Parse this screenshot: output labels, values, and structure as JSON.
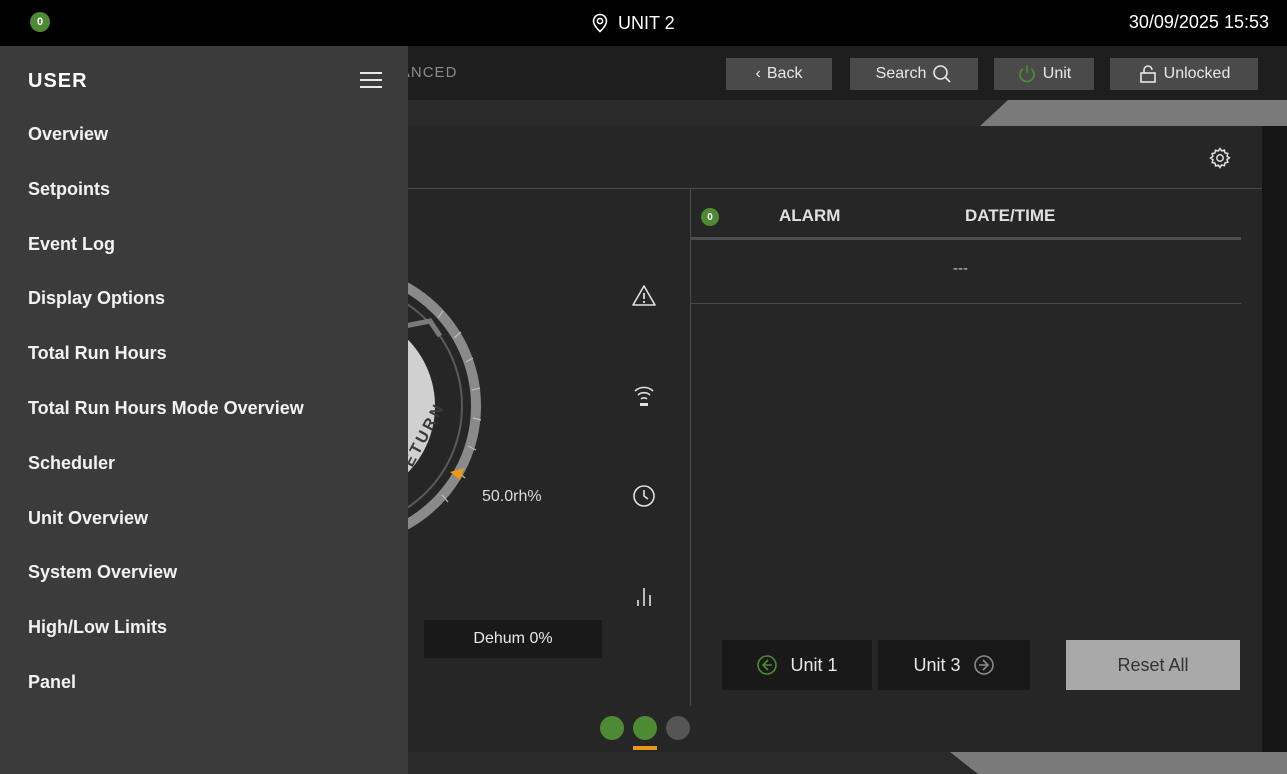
{
  "topbar": {
    "alarm_badge": "0",
    "unit_label": "UNIT 2",
    "datetime": "30/09/2025 15:53"
  },
  "toolbar": {
    "partial_tab": "VANCED",
    "back_label": "Back",
    "search_label": "Search",
    "unit_label": "Unit",
    "lock_label": "Unlocked"
  },
  "menu": {
    "title": "USER",
    "items": [
      {
        "label": "Overview"
      },
      {
        "label": "Setpoints"
      },
      {
        "label": "Event Log"
      },
      {
        "label": "Display Options"
      },
      {
        "label": "Total Run Hours"
      },
      {
        "label": "Total Run Hours Mode Overview"
      },
      {
        "label": "Scheduler"
      },
      {
        "label": "Unit Overview"
      },
      {
        "label": "System Overview"
      },
      {
        "label": "High/Low Limits"
      },
      {
        "label": "Panel"
      }
    ]
  },
  "gauge": {
    "partial_label": "ETURN",
    "setpoint": "50.0rh%",
    "dehum": "Dehum 0%"
  },
  "alarms": {
    "count": "0",
    "col_alarm": "ALARM",
    "col_datetime": "DATE/TIME",
    "empty_row": "---"
  },
  "navigation": {
    "prev_unit": "Unit 1",
    "next_unit": "Unit 3",
    "reset": "Reset All"
  },
  "colors": {
    "ok_green": "#4e8a34",
    "accent_orange": "#e59b16",
    "menu_bg": "#3b3b3b"
  }
}
